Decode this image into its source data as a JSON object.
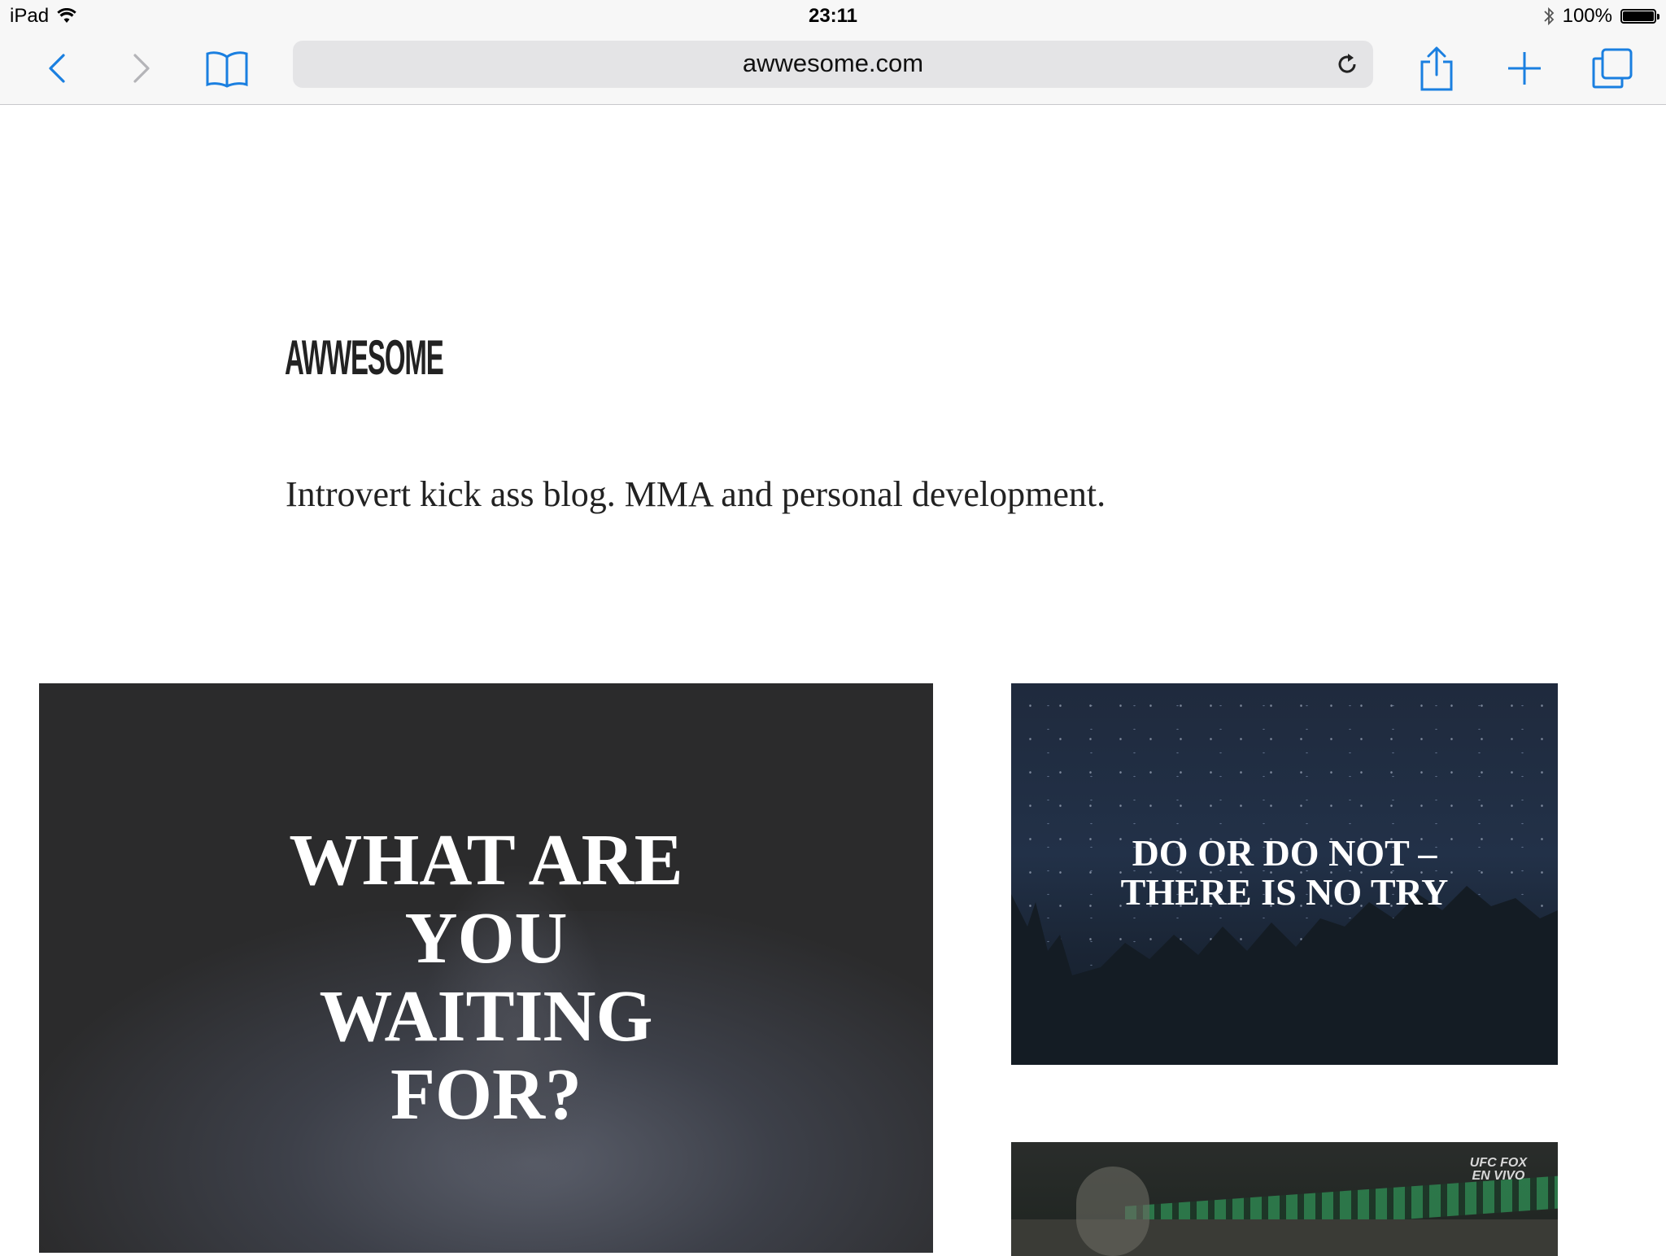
{
  "status_bar": {
    "device": "iPad",
    "time": "23:11",
    "battery": "100%",
    "battery_level": 1.0
  },
  "toolbar": {
    "url": "awwesome.com",
    "icons": [
      "back-icon",
      "forward-icon",
      "bookmarks-icon",
      "reload-icon",
      "share-icon",
      "new-tab-icon",
      "tabs-icon"
    ]
  },
  "page": {
    "logo": "AWWESOME",
    "tagline": "Introvert kick ass blog. MMA and personal development.",
    "posts": [
      {
        "title_lines": [
          "WHAT ARE",
          "YOU",
          "WAITING",
          "FOR?"
        ]
      },
      {
        "title_lines": [
          "DO OR DO NOT –",
          "THERE IS NO TRY"
        ]
      },
      {
        "overlay_lines": [
          "UFC FOX",
          "EN VIVO"
        ]
      }
    ]
  },
  "colors": {
    "accent": "#1a7fe0",
    "toolbar_bg": "#f7f7f7",
    "card_dark": "#2b2b2c",
    "night_sky": "#1f2a3d"
  }
}
